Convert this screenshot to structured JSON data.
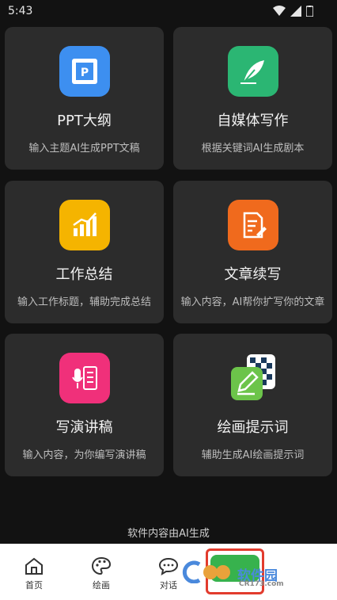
{
  "status": {
    "time": "5:43"
  },
  "cards": [
    {
      "title": "PPT大纲",
      "desc": "输入主题AI生成PPT文稿",
      "icon": "ppt-icon",
      "color": "#3d8ff0"
    },
    {
      "title": "自媒体写作",
      "desc": "根据关键词AI生成剧本",
      "icon": "feather-icon",
      "color": "#2bb673"
    },
    {
      "title": "工作总结",
      "desc": "输入工作标题，辅助完成总结",
      "icon": "chart-icon",
      "color": "#f5b400"
    },
    {
      "title": "文章续写",
      "desc": "输入内容，AI帮你扩写你的文章",
      "icon": "document-edit-icon",
      "color": "#f06a1d"
    },
    {
      "title": "写演讲稿",
      "desc": "输入内容，为你编写演讲稿",
      "icon": "microphone-icon",
      "color": "#f0307a"
    },
    {
      "title": "绘画提示词",
      "desc": "辅助生成AI绘画提示词",
      "icon": "paint-icon",
      "color": "#6cc44a"
    }
  ],
  "footer_note": "软件内容由AI生成",
  "nav": [
    {
      "label": "首页",
      "icon": "home-icon"
    },
    {
      "label": "绘画",
      "icon": "palette-icon"
    },
    {
      "label": "对话",
      "icon": "chat-icon"
    }
  ],
  "watermark": {
    "text": "软件园",
    "sub": "CR173.com"
  }
}
